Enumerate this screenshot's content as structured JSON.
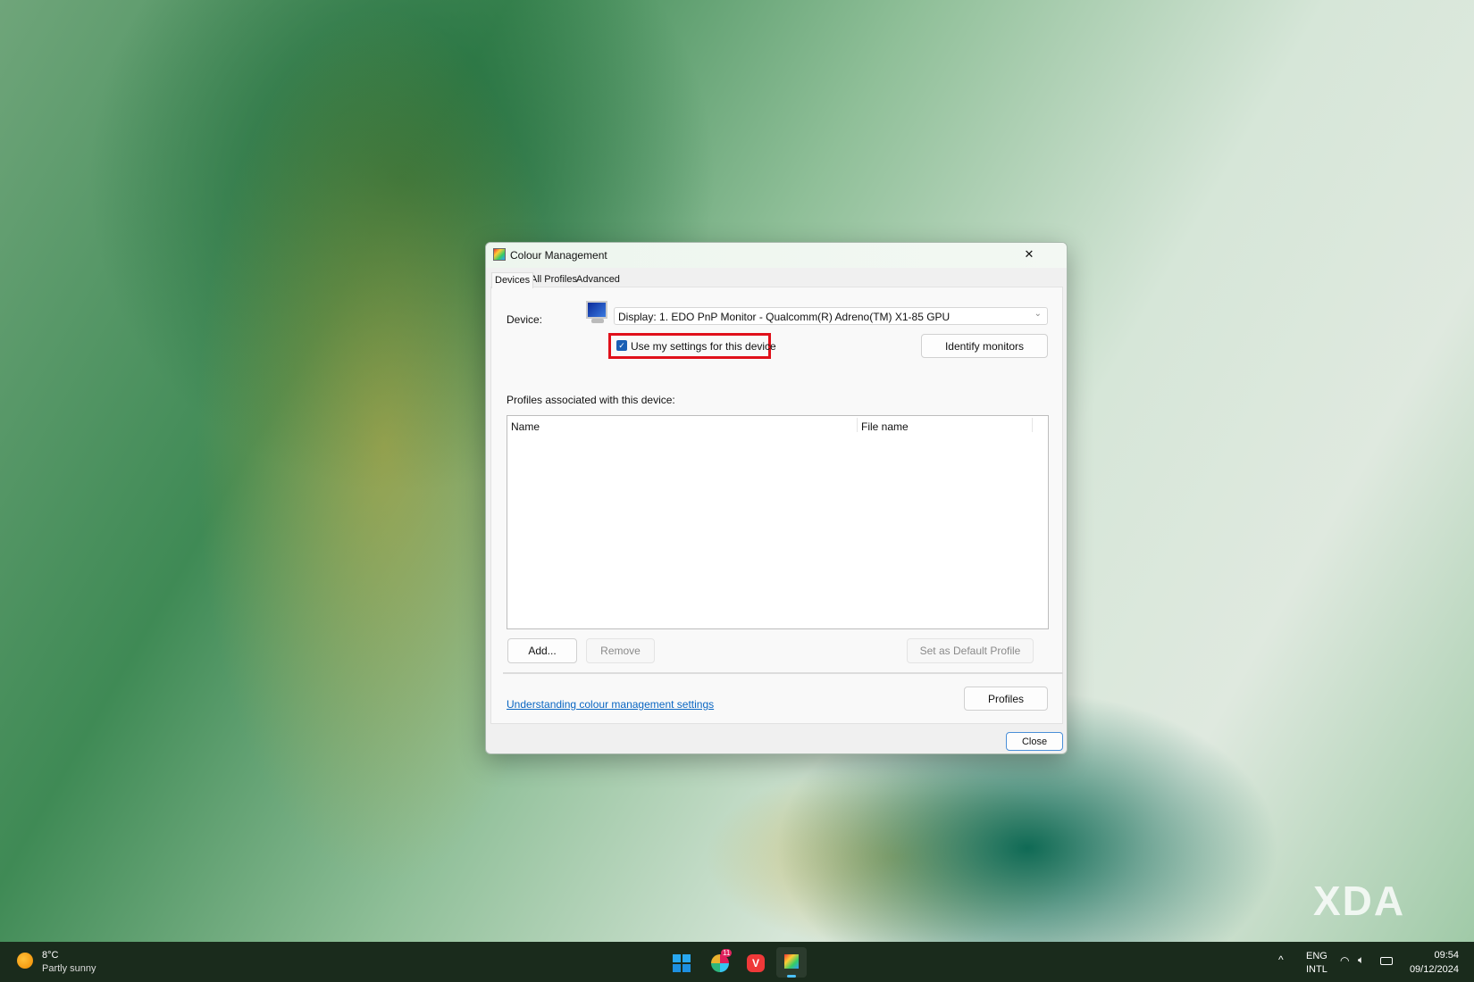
{
  "window": {
    "title": "Colour Management",
    "close_glyph": "✕"
  },
  "tabs": [
    {
      "label": "Devices",
      "active": true
    },
    {
      "label": "All Profiles"
    },
    {
      "label": "Advanced"
    }
  ],
  "devices": {
    "device_label": "Device:",
    "device_value": "Display: 1. EDO PnP Monitor - Qualcomm(R) Adreno(TM) X1-85 GPU",
    "use_my_settings_label": "Use my settings for this device",
    "use_my_settings_checked": true,
    "identify_button": "Identify monitors",
    "profiles_label": "Profiles associated with this device:",
    "columns": [
      "Name",
      "File name"
    ],
    "rows": [],
    "add_button": "Add...",
    "remove_button": "Remove",
    "set_default_button": "Set as Default Profile",
    "help_link": "Understanding colour management settings",
    "profiles_button": "Profiles"
  },
  "close_button": "Close",
  "highlight_color": "#e0101a",
  "taskbar": {
    "weather_temp": "8°C",
    "weather_desc": "Partly sunny",
    "badge_count": "11",
    "lang_1": "ENG",
    "lang_2": "INTL",
    "time": "09:54",
    "date": "09/12/2024"
  },
  "watermark": "XDA"
}
